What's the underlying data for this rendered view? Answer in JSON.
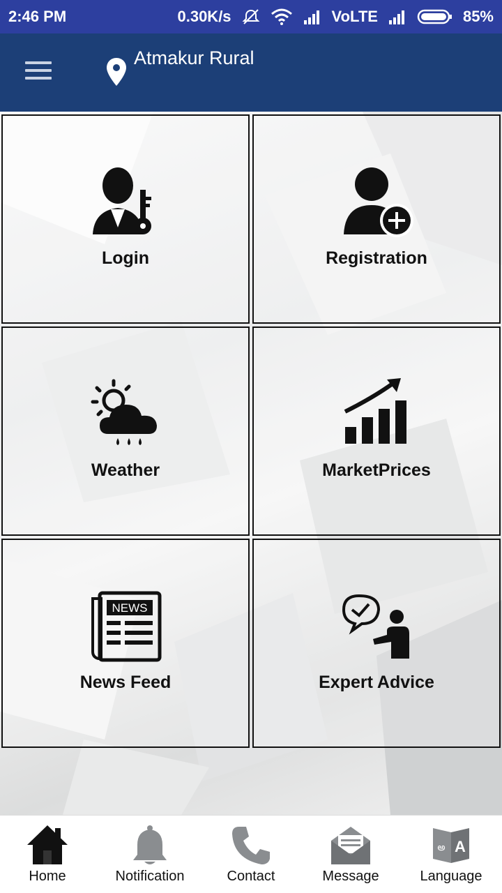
{
  "status_bar": {
    "time": "2:46 PM",
    "speed": "0.30K/s",
    "network": "VoLTE",
    "battery": "85%"
  },
  "app_bar": {
    "location": "Atmakur Rural"
  },
  "tiles": [
    {
      "label": "Login",
      "icon": "user-key-icon"
    },
    {
      "label": "Registration",
      "icon": "add-user-icon"
    },
    {
      "label": "Weather",
      "icon": "weather-icon"
    },
    {
      "label": "MarketPrices",
      "icon": "chart-growth-icon"
    },
    {
      "label": "News Feed",
      "icon": "newspaper-icon"
    },
    {
      "label": "Expert Advice",
      "icon": "expert-advice-icon"
    }
  ],
  "bottom_nav": [
    {
      "label": "Home",
      "icon": "home-icon"
    },
    {
      "label": "Notification",
      "icon": "bell-icon"
    },
    {
      "label": "Contact",
      "icon": "phone-icon"
    },
    {
      "label": "Message",
      "icon": "envelope-icon"
    },
    {
      "label": "Language",
      "icon": "translate-icon"
    }
  ]
}
